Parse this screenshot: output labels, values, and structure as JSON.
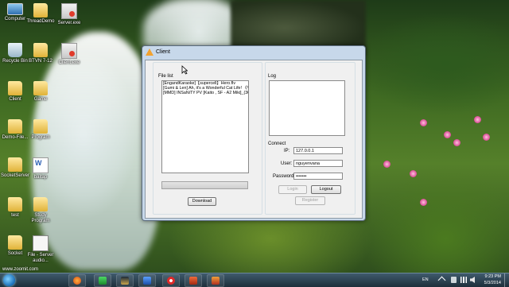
{
  "desktop": {
    "icons": [
      {
        "label": "Computer",
        "type": "computer"
      },
      {
        "label": "ThreadDemo",
        "type": "folder"
      },
      {
        "label": "Server.exe",
        "type": "exe"
      },
      {
        "label": "Recycle Bin",
        "type": "bin"
      },
      {
        "label": "BTVN 7-12",
        "type": "folder"
      },
      {
        "label": "Client.exe",
        "type": "exe"
      },
      {
        "label": "Client",
        "type": "folder"
      },
      {
        "label": "Game",
        "type": "folder"
      },
      {
        "label": "Demo-File...",
        "type": "folder"
      },
      {
        "label": "Program",
        "type": "folder"
      },
      {
        "label": "SocketServer",
        "type": "folder"
      },
      {
        "label": "baitap",
        "type": "doc"
      },
      {
        "label": "test",
        "type": "folder"
      },
      {
        "label": "Study Program",
        "type": "folder"
      },
      {
        "label": "Socket",
        "type": "folder"
      },
      {
        "label": "File - Server audio...",
        "type": "file"
      }
    ],
    "watermark": "www.zoomit.com"
  },
  "window": {
    "title": "Client",
    "file_list": {
      "label": "File list",
      "items": [
        "[EngandKaraoke]【supercell】Hero.flv",
        "[Gumi & Len] Ah, it's a Wonderful Cat Life! 《VO",
        "[MMD] INSaNiTY PV [Kaito , SF - A2 Miki]_(360p"
      ]
    },
    "progress": {
      "value": 0
    },
    "download_label": "Download",
    "log": {
      "label": "Log",
      "text": ""
    },
    "connect": {
      "label": "Connect",
      "ip_label": "IP:",
      "ip_value": "127.0.0.1",
      "user_label": "User:",
      "user_value": "nguyenvana",
      "password_label": "Password:",
      "password_value": "•••••••",
      "login_label": "Login",
      "logout_label": "Logout",
      "register_label": "Register"
    }
  },
  "taskbar": {
    "language": "EN",
    "time": "9:23 PM",
    "date": "5/3/2014",
    "pinned": [
      "firefox-icon",
      "download-manager-icon",
      "league-icon",
      "network-icon",
      "record-icon",
      "app-icon",
      "app-icon-2"
    ]
  }
}
